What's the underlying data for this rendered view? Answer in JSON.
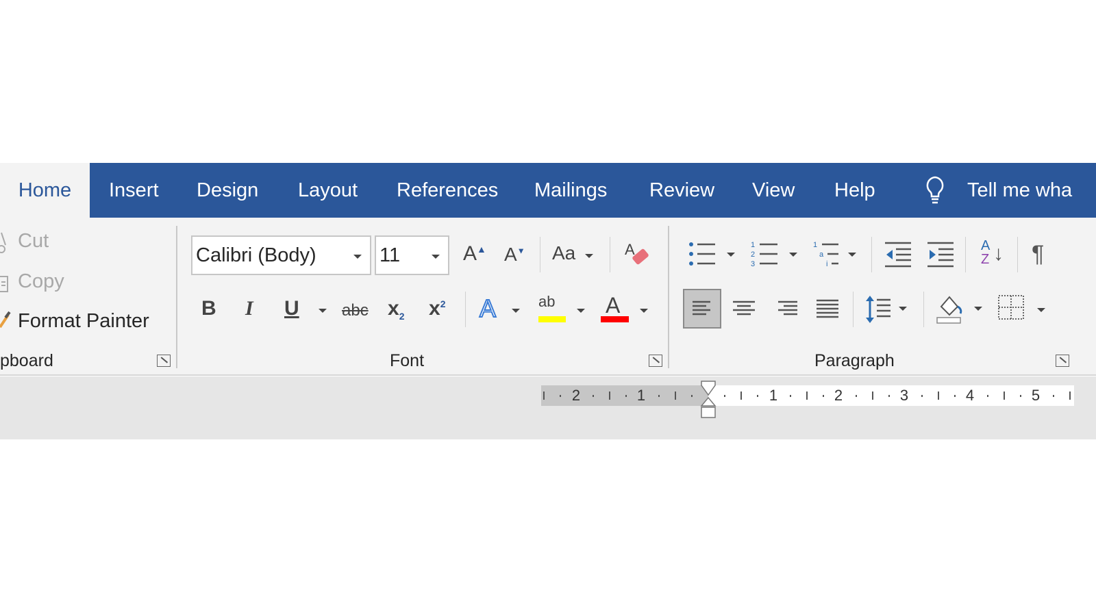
{
  "tabs": [
    {
      "label": "Home",
      "active": true
    },
    {
      "label": "Insert"
    },
    {
      "label": "Design"
    },
    {
      "label": "Layout"
    },
    {
      "label": "References"
    },
    {
      "label": "Mailings"
    },
    {
      "label": "Review"
    },
    {
      "label": "View"
    },
    {
      "label": "Help"
    }
  ],
  "tell_me": {
    "icon": "lightbulb-icon",
    "label": "Tell me wha"
  },
  "clipboard": {
    "cut": "Cut",
    "copy": "Copy",
    "format_painter": "Format Painter",
    "group_label": "pboard"
  },
  "font": {
    "name": "Calibri (Body)",
    "size": "11",
    "group_label": "Font",
    "change_case": "Aa",
    "bold": "B",
    "italic": "I",
    "underline": "U",
    "strike": "abc",
    "sub": "x",
    "sub_mark": "2",
    "sup": "x",
    "sup_mark": "2",
    "text_effects": "A",
    "highlight": "ab",
    "font_color": "A",
    "grow": "A",
    "shrink": "A",
    "highlight_color": "#ffff00",
    "font_color_value": "#ff0000"
  },
  "paragraph": {
    "group_label": "Paragraph",
    "pilcrow": "¶",
    "sort_a": "A",
    "sort_z": "Z"
  },
  "ruler": {
    "labels_left": [
      "2",
      "1"
    ],
    "labels_right": [
      "1",
      "2",
      "3",
      "4",
      "5"
    ]
  },
  "colors": {
    "tabbar": "#2b579a",
    "ribbon": "#f3f3f3"
  }
}
